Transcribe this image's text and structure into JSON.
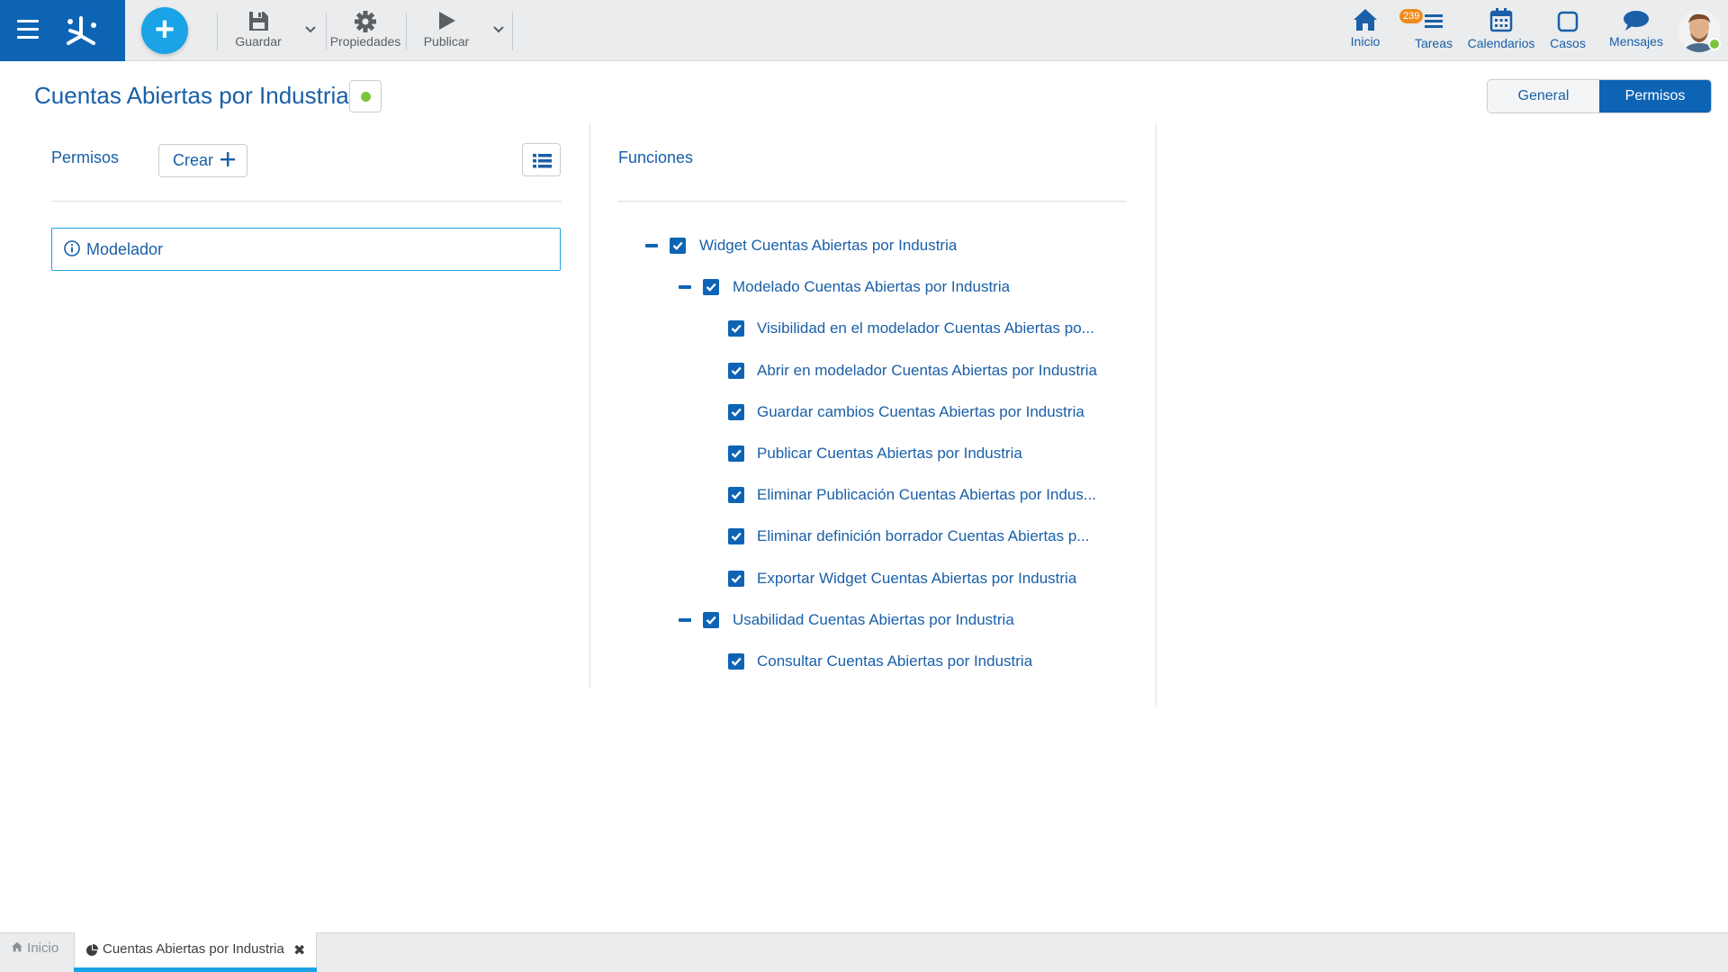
{
  "toolbar": {
    "guardar_label": "Guardar",
    "propiedades_label": "Propiedades",
    "publicar_label": "Publicar"
  },
  "nav": {
    "inicio": "Inicio",
    "tareas": "Tareas",
    "tareas_badge": "239",
    "calendarios": "Calendarios",
    "casos": "Casos",
    "mensajes": "Mensajes"
  },
  "header": {
    "title": "Cuentas Abiertas por Industria",
    "tabs": [
      {
        "label": "General",
        "active": false
      },
      {
        "label": "Permisos",
        "active": true
      }
    ]
  },
  "permisos": {
    "title": "Permisos",
    "crear_label": "Crear",
    "items": [
      "Modelador"
    ]
  },
  "funciones": {
    "title": "Funciones",
    "tree": [
      {
        "label": "Widget Cuentas Abiertas por Industria",
        "level": 0,
        "expanded": true,
        "checked": true
      },
      {
        "label": "Modelado Cuentas Abiertas por Industria",
        "level": 1,
        "expanded": true,
        "checked": true
      },
      {
        "label": "Visibilidad en el modelador Cuentas Abiertas po...",
        "level": 2,
        "checked": true
      },
      {
        "label": "Abrir en modelador Cuentas Abiertas por Industria",
        "level": 2,
        "checked": true
      },
      {
        "label": "Guardar cambios Cuentas Abiertas por Industria",
        "level": 2,
        "checked": true
      },
      {
        "label": "Publicar Cuentas Abiertas por Industria",
        "level": 2,
        "checked": true
      },
      {
        "label": "Eliminar Publicación Cuentas Abiertas por Indus...",
        "level": 2,
        "checked": true
      },
      {
        "label": "Eliminar definición borrador Cuentas Abiertas p...",
        "level": 2,
        "checked": true
      },
      {
        "label": "Exportar Widget Cuentas Abiertas por Industria",
        "level": 2,
        "checked": true
      },
      {
        "label": "Usabilidad Cuentas Abiertas por Industria",
        "level": 1,
        "expanded": true,
        "checked": true
      },
      {
        "label": "Consultar Cuentas Abiertas por Industria",
        "level": 2,
        "checked": true
      }
    ]
  },
  "bottom_tabs": {
    "home": "Inicio",
    "active": "Cuentas Abiertas por Industria"
  },
  "colors": {
    "brand": "#0e64b4",
    "accent": "#1aa3e6",
    "status_active": "#7dc43a",
    "badge": "#f08c1c"
  }
}
